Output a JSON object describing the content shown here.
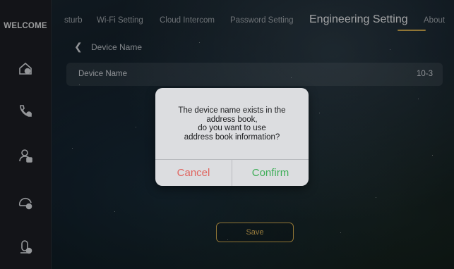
{
  "sidebar": {
    "welcome_label": "WELCOME",
    "items": [
      {
        "icon": "home-cloud-icon"
      },
      {
        "icon": "phone-settings-icon"
      },
      {
        "icon": "user-lock-icon"
      },
      {
        "icon": "network-check-icon"
      },
      {
        "icon": "device-settings-icon"
      }
    ]
  },
  "nav": {
    "tabs": [
      {
        "label": "sturb"
      },
      {
        "label": "Wi-Fi Setting"
      },
      {
        "label": "Cloud Intercom"
      },
      {
        "label": "Password Setting"
      },
      {
        "label": "Engineering Setting"
      },
      {
        "label": "About"
      }
    ],
    "active_tab": "Engineering Setting"
  },
  "page": {
    "back_icon": "chevron-left-icon",
    "title": "Device Name",
    "field_label": "Device Name",
    "field_value": "10-3",
    "save_label": "Save"
  },
  "dialog": {
    "message_lines": [
      "The device name exists in the",
      "address book,",
      "do you want to use",
      "address book information?"
    ],
    "cancel_label": "Cancel",
    "confirm_label": "Confirm"
  },
  "colors": {
    "accent": "#c8a24a",
    "cancel": "#e0655f",
    "confirm": "#3fae58",
    "dialog_bg": "#dcdde0"
  }
}
